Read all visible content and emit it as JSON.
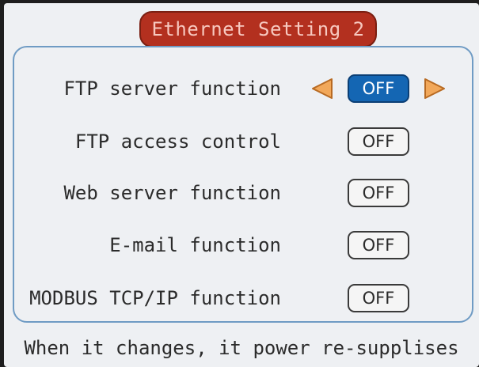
{
  "header": {
    "title": "Ethernet Setting 2"
  },
  "settings": [
    {
      "label": "FTP server function",
      "value": "OFF",
      "selected": true
    },
    {
      "label": "FTP access control",
      "value": "OFF",
      "selected": false
    },
    {
      "label": "Web server function",
      "value": "OFF",
      "selected": false
    },
    {
      "label": "E-mail function",
      "value": "OFF",
      "selected": false
    },
    {
      "label": "MODBUS TCP/IP function",
      "value": "OFF",
      "selected": false
    }
  ],
  "footer": {
    "message": "When it changes, it power re-supplises"
  },
  "colors": {
    "title_badge": "#b3301f",
    "selected_toggle": "#1466b3",
    "arrow": "#f2a85a",
    "panel_border": "#6f9bc4"
  },
  "icons": {
    "left": "left-triangle-arrow-icon",
    "right": "right-triangle-arrow-icon"
  }
}
